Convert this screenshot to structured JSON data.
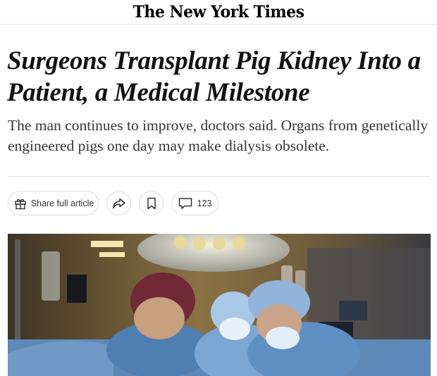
{
  "masthead": {
    "logo": "The New York Times"
  },
  "article": {
    "headline": "Surgeons Transplant Pig Kidney Into a Patient, a Medical Milestone",
    "summary": "The man continues to improve, doctors said. Organs from genetically engineered pigs one day may make dialysis obsolete."
  },
  "toolbar": {
    "share_label": "Share full article",
    "comment_count": "123",
    "icons": [
      "gift-icon",
      "share-arrow-icon",
      "bookmark-icon",
      "comment-icon"
    ]
  },
  "photo": {
    "subject": "Surgeons in an operating room"
  }
}
